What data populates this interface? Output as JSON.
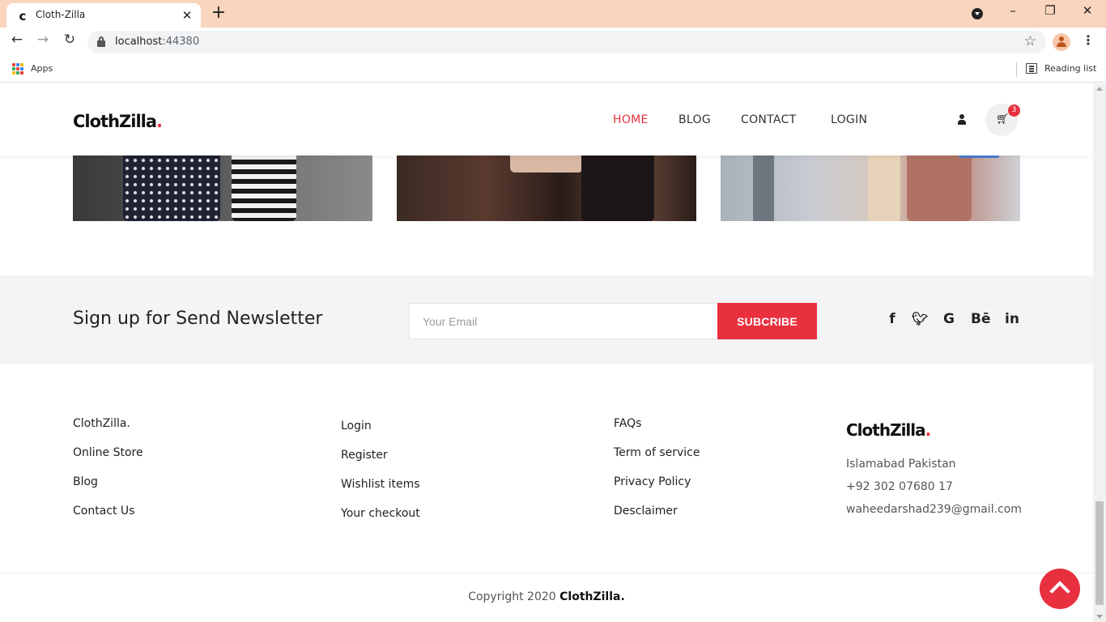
{
  "browser": {
    "tab_title": "Cloth-Zilla",
    "url_host": "localhost",
    "url_port": ":44380",
    "bookmarks_apps": "Apps",
    "reading_list": "Reading list"
  },
  "header": {
    "logo_text": "ClothZilla",
    "logo_dot": ".",
    "menu": [
      "HOME",
      "BLOG",
      "CONTACT",
      "LOGIN"
    ],
    "active_menu": "HOME",
    "cart_count": "3"
  },
  "newsletter": {
    "title": "Sign up for Send Newsletter",
    "email_placeholder": "Your Email",
    "button_label": "SUBCRIBE",
    "social_icons": [
      "facebook-icon",
      "twitter-icon",
      "google-icon",
      "behance-icon",
      "linkedin-icon"
    ]
  },
  "footer": {
    "col1": [
      "ClothZilla.",
      "Online Store",
      "Blog",
      "Contact Us"
    ],
    "col2": [
      "Login",
      "Register",
      "Wishlist items",
      "Your checkout"
    ],
    "col3": [
      "FAQs",
      "Term of service",
      "Privacy Policy",
      "Desclaimer"
    ],
    "logo_text": "ClothZilla",
    "logo_dot": ".",
    "address": "Islamabad Pakistan",
    "phone": "+92 302 07680 17",
    "email": "waheedarshad239@gmail.com"
  },
  "copyright": {
    "prefix": "Copyright 2020 ",
    "brand": "ClothZilla."
  },
  "colors": {
    "accent": "#e8303f",
    "tab_strip": "#f9d5bd"
  }
}
